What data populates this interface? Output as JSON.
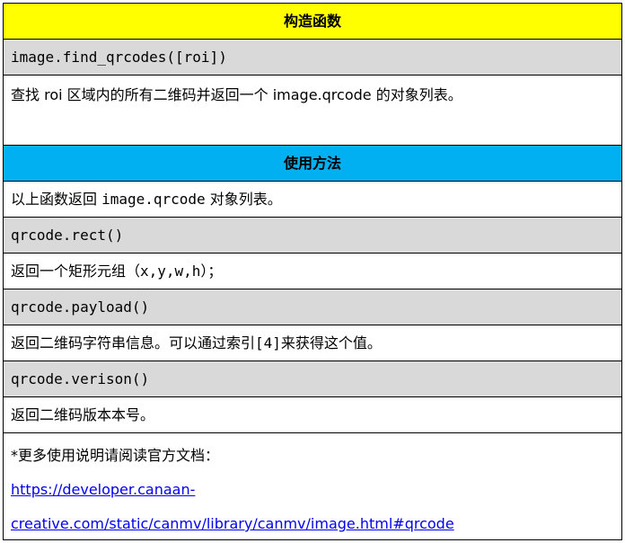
{
  "construct": {
    "header": "构造函数",
    "signature": "image.find_qrcodes([roi])",
    "description": "查找 roi 区域内的所有二维码并返回一个 image.qrcode 的对象列表。"
  },
  "usage": {
    "header": "使用方法",
    "intro_prefix": "以上函数返回 ",
    "intro_code": "image.qrcode",
    "intro_suffix": " 对象列表。",
    "methods": [
      {
        "signature": "qrcode.rect()",
        "description": "返回一个矩形元组（x,y,w,h）；"
      },
      {
        "signature": "qrcode.payload()",
        "description": "返回二维码字符串信息。可以通过索引[4]来获得这个值。"
      },
      {
        "signature": "qrcode.verison()",
        "description": "返回二维码版本本号。"
      }
    ],
    "note": "*更多使用说明请阅读官方文档：",
    "link_line1": "https://developer.canaan-",
    "link_line2": "creative.com/static/canmv/library/canmv/image.html#qrcode"
  }
}
